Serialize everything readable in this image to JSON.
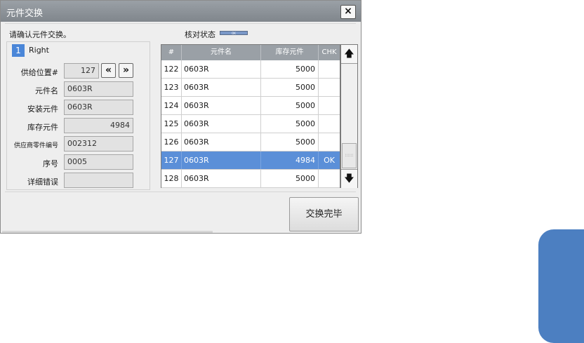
{
  "dialog": {
    "title": "元件交换",
    "close_label": "×",
    "prompt": "请确认元件交换。",
    "status_label": "核对状态",
    "status_indicator": "OK",
    "done_button": "交换完毕"
  },
  "side": {
    "number": "1",
    "label": "Right"
  },
  "form": {
    "feed_position": {
      "label": "供给位置#",
      "value": "127"
    },
    "prev_label": "«",
    "next_label": "»",
    "part_name": {
      "label": "元件名",
      "value": "0603R"
    },
    "mounted_part": {
      "label": "安装元件",
      "value": "0603R"
    },
    "stock_part": {
      "label": "库存元件",
      "value": "4984"
    },
    "vendor_part_no": {
      "label": "供应商零件编号",
      "value": "002312"
    },
    "serial": {
      "label": "序号",
      "value": "0005"
    },
    "error_detail": {
      "label": "详细错误",
      "value": ""
    }
  },
  "table": {
    "columns": [
      "#",
      "元件名",
      "库存元件",
      "CHK"
    ],
    "rows": [
      {
        "no": "122",
        "name": "0603R",
        "stock": "5000",
        "chk": ""
      },
      {
        "no": "123",
        "name": "0603R",
        "stock": "5000",
        "chk": ""
      },
      {
        "no": "124",
        "name": "0603R",
        "stock": "5000",
        "chk": ""
      },
      {
        "no": "125",
        "name": "0603R",
        "stock": "5000",
        "chk": ""
      },
      {
        "no": "126",
        "name": "0603R",
        "stock": "5000",
        "chk": ""
      },
      {
        "no": "127",
        "name": "0603R",
        "stock": "4984",
        "chk": "OK"
      },
      {
        "no": "128",
        "name": "0603R",
        "stock": "5000",
        "chk": ""
      }
    ],
    "selected_row": 5
  },
  "scroll": {
    "up_label": "🡅",
    "down_label": "🡇"
  },
  "colors": {
    "accent": "#4a86d8",
    "selected_row": "#5b8fd8",
    "titlebar": "#8c9298",
    "side_tab": "#4c7fc1"
  }
}
